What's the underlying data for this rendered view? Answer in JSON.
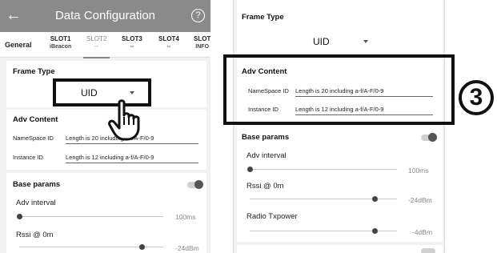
{
  "left_screen": {
    "appbar": {
      "back_glyph": "←",
      "title": "Data Configuration",
      "help_glyph": "?"
    },
    "tabs": [
      {
        "label": "General",
        "sub": ""
      },
      {
        "label": "SLOT1",
        "sub": "iBeacon"
      },
      {
        "label": "SLOT2",
        "sub": "--"
      },
      {
        "label": "SLOT3",
        "sub": "--"
      },
      {
        "label": "SLOT4",
        "sub": "--"
      },
      {
        "label": "SLOT",
        "sub": "INFO"
      }
    ],
    "frame_type": {
      "title": "Frame Type",
      "value": "UID"
    },
    "adv_content": {
      "title": "Adv Content",
      "namespace_label": "NameSpace ID",
      "namespace_value": "Length is 20 including a-f/A-F/0-9",
      "instance_label": "Instance ID",
      "instance_value": "Length is 12 including a-f/A-F/0-9"
    },
    "base_params": {
      "title": "Base params",
      "adv_interval_label": "Adv interval",
      "adv_interval_value": "100ms",
      "adv_interval_fraction": 0.0,
      "rssi_label": "Rssi @ 0m",
      "rssi_value": "-24dBm",
      "rssi_fraction": 0.85
    }
  },
  "right_screen": {
    "frame_type": {
      "title": "Frame Type",
      "value": "UID"
    },
    "adv_content": {
      "title": "Adv Content",
      "namespace_label": "NameSpace ID",
      "namespace_value": "Length is 20 including a-f/A-F/0-9",
      "instance_label": "Instance ID",
      "instance_value": "Length is 12 including a-f/A-F/0-9"
    },
    "base_params": {
      "title": "Base params",
      "adv_interval_label": "Adv interval",
      "adv_interval_value": "100ms",
      "adv_interval_fraction": 0.0,
      "rssi_label": "Rssi @ 0m",
      "rssi_value": "-24dBm",
      "rssi_fraction": 0.85,
      "tx_power_label": "Radio Txpower",
      "tx_power_value": "-4dBm",
      "tx_power_fraction": 0.85
    }
  },
  "step_marker": "3",
  "colors": {
    "appbar": "#8a8a8a",
    "background": "#f2f2f2",
    "highlight": "#111111",
    "slider_thumb": "#444444"
  }
}
